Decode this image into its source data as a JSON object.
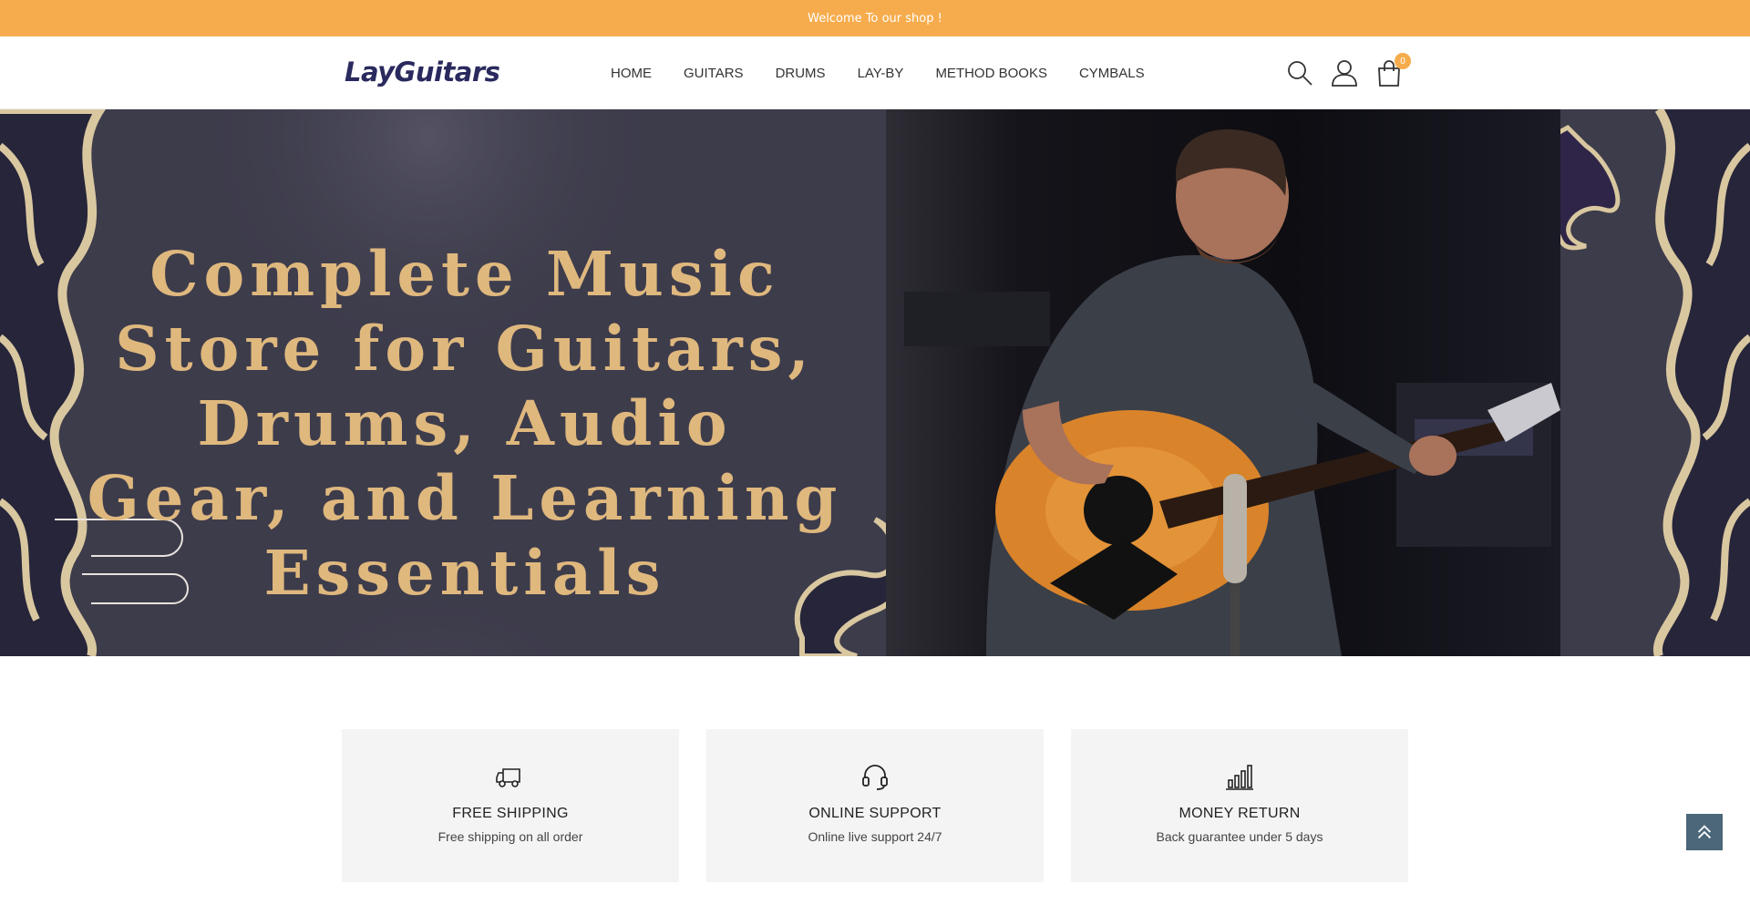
{
  "topbar": {
    "text": "Welcome To our shop !"
  },
  "header": {
    "logo": "LayGuitars",
    "nav": [
      {
        "label": "HOME"
      },
      {
        "label": "GUITARS"
      },
      {
        "label": "DRUMS"
      },
      {
        "label": "LAY-BY"
      },
      {
        "label": "METHOD BOOKS"
      },
      {
        "label": "CYMBALS"
      }
    ],
    "icons": {
      "search": "search-icon",
      "account": "user-icon",
      "cart": "cart-icon"
    },
    "cart_count": "0"
  },
  "hero": {
    "title": "Complete Music Store for Guitars, Drums, Audio Gear, and Learning Essentials",
    "image": "man-playing-acoustic-guitar"
  },
  "features": [
    {
      "icon": "truck-icon",
      "title": "FREE SHIPPING",
      "subtitle": "Free shipping on all order"
    },
    {
      "icon": "headset-icon",
      "title": "ONLINE SUPPORT",
      "subtitle": "Online live support 24/7"
    },
    {
      "icon": "bar-chart-icon",
      "title": "MONEY RETURN",
      "subtitle": "Back guarantee under 5 days"
    }
  ],
  "colors": {
    "accent": "#f6ac4c",
    "logo": "#2a2a5e",
    "hero_bg": "#3d3c4b",
    "hero_text": "#dfb87e",
    "feature_bg": "#f4f4f4",
    "scroll_top_bg": "#4b6779"
  }
}
